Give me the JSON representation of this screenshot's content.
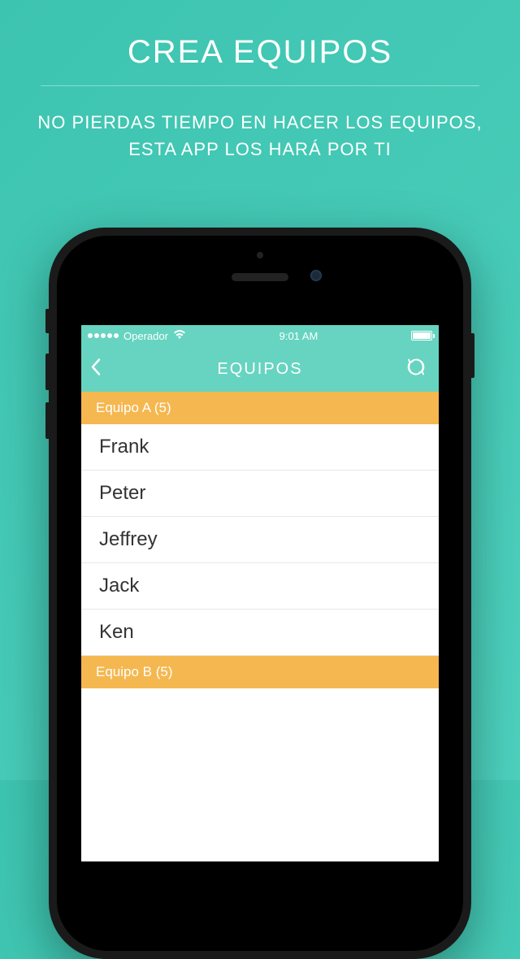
{
  "promo": {
    "title": "CREA EQUIPOS",
    "subtitle": "NO PIERDAS TIEMPO EN HACER LOS EQUIPOS, ESTA APP LOS HARÁ POR TI"
  },
  "status": {
    "carrier": "Operador",
    "time": "9:01 AM"
  },
  "nav": {
    "title": "EQUIPOS"
  },
  "sections": [
    {
      "label": "Equipo A (5)",
      "items": [
        "Frank",
        "Peter",
        "Jeffrey",
        "Jack",
        "Ken"
      ]
    },
    {
      "label": "Equipo B (5)",
      "items": []
    }
  ]
}
